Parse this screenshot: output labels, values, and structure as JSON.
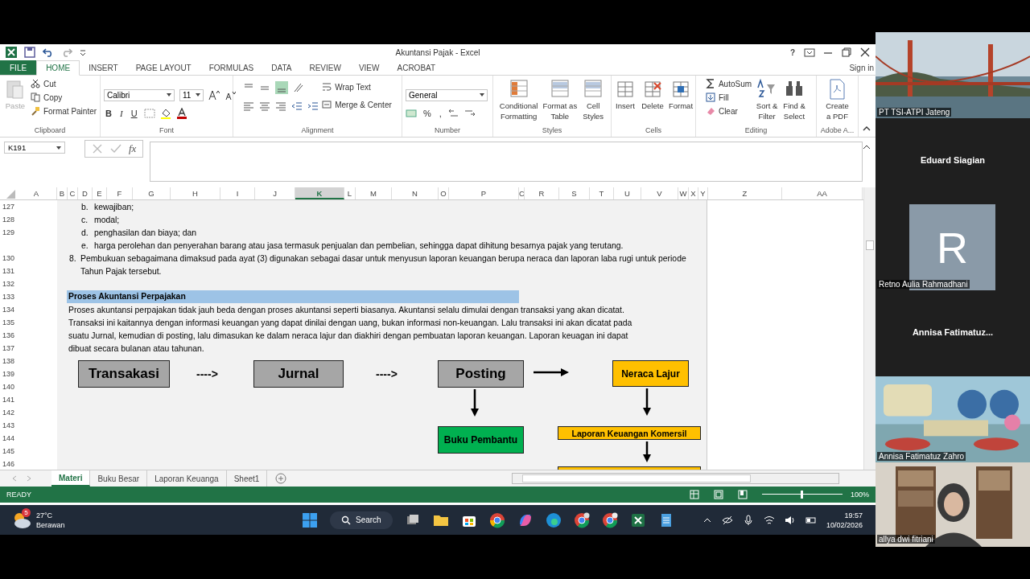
{
  "window": {
    "title": "Akuntansi Pajak - Excel",
    "help": "?",
    "sign_in": "Sign in"
  },
  "ribbon_tabs": [
    {
      "label": "FILE",
      "kind": "file",
      "selected": false
    },
    {
      "label": "HOME",
      "kind": "tab",
      "selected": true
    },
    {
      "label": "INSERT",
      "kind": "tab",
      "selected": false
    },
    {
      "label": "PAGE LAYOUT",
      "kind": "tab",
      "selected": false
    },
    {
      "label": "FORMULAS",
      "kind": "tab",
      "selected": false
    },
    {
      "label": "DATA",
      "kind": "tab",
      "selected": false
    },
    {
      "label": "REVIEW",
      "kind": "tab",
      "selected": false
    },
    {
      "label": "VIEW",
      "kind": "tab",
      "selected": false
    },
    {
      "label": "ACROBAT",
      "kind": "tab",
      "selected": false
    }
  ],
  "clipboard": {
    "paste": "Paste",
    "cut": "Cut",
    "copy": "Copy",
    "format_painter": "Format Painter",
    "label": "Clipboard"
  },
  "font": {
    "name": "Calibri",
    "size": "11",
    "bold": "B",
    "italic": "I",
    "underline": "U",
    "label": "Font"
  },
  "alignment": {
    "wrap_text": "Wrap Text",
    "merge_center": "Merge & Center",
    "label": "Alignment"
  },
  "number": {
    "format": "General",
    "percent": "%",
    "comma": ",",
    "label": "Number"
  },
  "styles": {
    "label": "Styles",
    "buttons": [
      {
        "lines": [
          "Conditional",
          "Formatting"
        ]
      },
      {
        "lines": [
          "Format as",
          "Table"
        ]
      },
      {
        "lines": [
          "Cell",
          "Styles"
        ]
      }
    ]
  },
  "cells": {
    "label": "Cells",
    "buttons": [
      {
        "lines": [
          "Insert"
        ]
      },
      {
        "lines": [
          "Delete"
        ]
      },
      {
        "lines": [
          "Format"
        ]
      }
    ]
  },
  "editing": {
    "label": "Editing",
    "autosum": "AutoSum",
    "fill": "Fill",
    "clear": "Clear",
    "buttons": [
      {
        "lines": [
          "Sort &",
          "Filter"
        ]
      },
      {
        "lines": [
          "Find &",
          "Select"
        ]
      }
    ]
  },
  "adobe": {
    "label": "Adobe A...",
    "buttons": [
      {
        "lines": [
          "Create",
          "a PDF"
        ]
      }
    ]
  },
  "name_box": "K191",
  "fx": "fx",
  "columns": [
    {
      "label": "A",
      "selected": false
    },
    {
      "label": "B",
      "selected": false
    },
    {
      "label": "C",
      "selected": false
    },
    {
      "label": "D",
      "selected": false
    },
    {
      "label": "E",
      "selected": false
    },
    {
      "label": "F",
      "selected": false
    },
    {
      "label": "G",
      "selected": false
    },
    {
      "label": "H",
      "selected": false
    },
    {
      "label": "I",
      "selected": false
    },
    {
      "label": "J",
      "selected": false
    },
    {
      "label": "K",
      "selected": true
    },
    {
      "label": "L",
      "selected": false
    },
    {
      "label": "M",
      "selected": false
    },
    {
      "label": "N",
      "selected": false
    },
    {
      "label": "O",
      "selected": false
    },
    {
      "label": "P",
      "selected": false
    },
    {
      "label": "C",
      "selected": false
    },
    {
      "label": "R",
      "selected": false
    },
    {
      "label": "S",
      "selected": false
    },
    {
      "label": "T",
      "selected": false
    },
    {
      "label": "U",
      "selected": false
    },
    {
      "label": "V",
      "selected": false
    },
    {
      "label": "W",
      "selected": false
    },
    {
      "label": "X",
      "selected": false
    },
    {
      "label": "Y",
      "selected": false
    },
    {
      "label": "Z",
      "selected": false
    },
    {
      "label": "AA",
      "selected": false
    }
  ],
  "rows": [
    {
      "number": "127",
      "kind": "list",
      "marker": "b.",
      "text": "kewajiban;"
    },
    {
      "number": "128",
      "kind": "list",
      "marker": "c.",
      "text": "modal;"
    },
    {
      "number": "129",
      "kind": "list",
      "marker": "d.",
      "text": "penghasilan dan biaya; dan"
    },
    {
      "kind": "list",
      "marker": "e.",
      "text": "harga perolehan dan penyerahan barang atau jasa termasuk penjualan dan pembelian, sehingga dapat dihitung besarnya pajak yang terutang."
    },
    {
      "number": "130",
      "kind": "numbered",
      "label": "8.",
      "text": "Pembukuan sebagaimana dimaksud pada ayat (3) digunakan sebagai dasar untuk menyusun laporan keuangan berupa neraca dan laporan laba rugi untuk periode"
    },
    {
      "number": "131",
      "kind": "continued",
      "text": "Tahun Pajak tersebut."
    },
    {
      "number": "132",
      "kind": "empty"
    },
    {
      "number": "133",
      "kind": "heading",
      "text": "Proses Akuntansi Perpajakan"
    },
    {
      "number": "134",
      "kind": "para",
      "text": "Proses akuntansi perpajakan tidak jauh beda dengan proses akuntansi seperti biasanya. Akuntansi selalu dimulai dengan transaksi yang akan dicatat."
    },
    {
      "number": "135",
      "kind": "para",
      "text": "Transaksi ini kaitannya dengan informasi keuangan yang dapat dinilai dengan uang, bukan informasi non-keuangan. Lalu transaksi ini akan dicatat pada"
    },
    {
      "number": "136",
      "kind": "para",
      "text": "suatu Jurnal, kemudian di posting, lalu dimasukan ke dalam neraca lajur dan diakhiri dengan pembuatan laporan keuangan. Laporan keuagan ini dapat"
    },
    {
      "number": "137",
      "kind": "para",
      "text": "dibuat secara bulanan atau tahunan."
    },
    {
      "number": "138",
      "kind": "empty"
    },
    {
      "number": "139",
      "kind": "empty"
    },
    {
      "number": "140",
      "kind": "empty"
    },
    {
      "number": "141",
      "kind": "empty"
    },
    {
      "number": "142",
      "kind": "empty"
    },
    {
      "number": "143",
      "kind": "empty"
    },
    {
      "number": "144",
      "kind": "empty"
    },
    {
      "number": "145",
      "kind": "empty"
    },
    {
      "number": "146",
      "kind": "empty"
    }
  ],
  "diagram": {
    "nodes": [
      {
        "label": "Transakasi",
        "color": "#a6a6a6"
      },
      {
        "label": "Jurnal",
        "color": "#a6a6a6"
      },
      {
        "label": "Posting",
        "color": "#a6a6a6"
      },
      {
        "label": "Neraca Lajur",
        "color": "#ffc000"
      },
      {
        "label": "Buku Pembantu",
        "color": "#00b050"
      },
      {
        "label": "Laporan Keuangan Komersil",
        "color": "#ffc000"
      },
      {
        "color": "#ffc000"
      }
    ],
    "text_arrows": [
      "---->",
      "---->"
    ]
  },
  "sheet_tabs": [
    {
      "label": "Materi",
      "selected": true
    },
    {
      "label": "Buku Besar",
      "selected": false
    },
    {
      "label": "Laporan Keuanga",
      "selected": false
    },
    {
      "label": "Sheet1",
      "selected": false
    }
  ],
  "status": {
    "text": "READY",
    "zoom": "100%",
    "level": 0.5
  },
  "taskbar": {
    "temperature": "27°C",
    "weather": "Berawan",
    "badge": "5",
    "search": "Search",
    "time": "19:57",
    "date": "10/02/2026"
  },
  "participants": [
    {
      "name": "PT TSI-ATPI Jateng",
      "kind": "bridge"
    },
    {
      "name": "Eduard Siagian",
      "kind": "name"
    },
    {
      "name": "Retno Aulia Rahmadhani",
      "kind": "avatar",
      "initial": "R"
    },
    {
      "name": "Annisa  Fatimatuz...",
      "kind": "name"
    },
    {
      "name": "Annisa Fatimatuz Zahro",
      "kind": "cartoon"
    },
    {
      "name": "allya dwi fitriani",
      "kind": "room"
    }
  ]
}
